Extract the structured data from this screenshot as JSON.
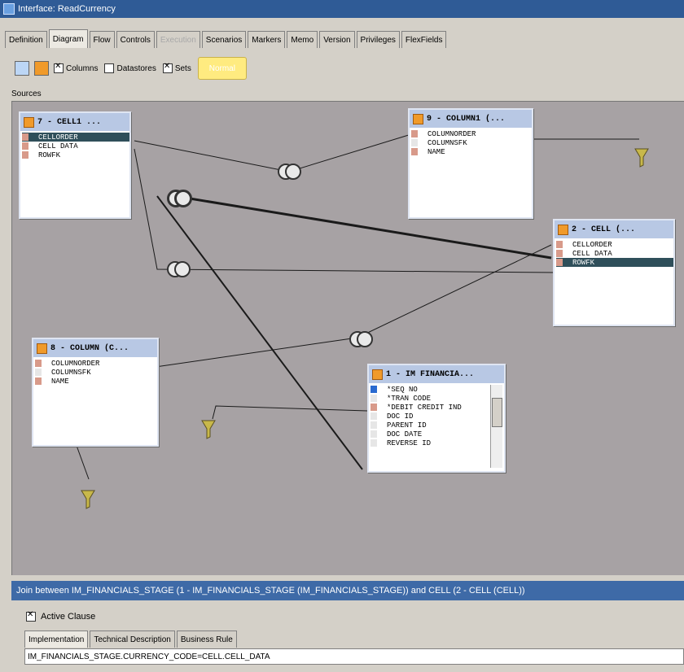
{
  "window": {
    "title": "Interface: ReadCurrency"
  },
  "tabs": [
    {
      "label": "Definition"
    },
    {
      "label": "Diagram"
    },
    {
      "label": "Flow"
    },
    {
      "label": "Controls"
    },
    {
      "label": "Execution"
    },
    {
      "label": "Scenarios"
    },
    {
      "label": "Markers"
    },
    {
      "label": "Memo"
    },
    {
      "label": "Version"
    },
    {
      "label": "Privileges"
    },
    {
      "label": "FlexFields"
    }
  ],
  "toolbar": {
    "columns_label": "Columns",
    "datastores_label": "Datastores",
    "sets_label": "Sets",
    "yellow_button_label": "Normal"
  },
  "sources_label": "Sources",
  "boxes": {
    "cell1": {
      "title": "7 - CELL1 ...",
      "rows": [
        "CELLORDER",
        "CELL DATA",
        "ROWFK"
      ]
    },
    "column1": {
      "title": "9 - COLUMN1 (...",
      "rows": [
        "COLUMNORDER",
        "COLUMNSFK",
        "NAME"
      ]
    },
    "cell": {
      "title": "2 - CELL (...",
      "rows": [
        "CELLORDER",
        "CELL DATA",
        "ROWFK"
      ]
    },
    "column": {
      "title": "8 - COLUMN (C...",
      "rows": [
        "COLUMNORDER",
        "COLUMNSFK",
        "NAME"
      ]
    },
    "imfin": {
      "title": "1 - IM FINANCIA...",
      "rows": [
        "*SEQ NO",
        "*TRAN CODE",
        "*DEBIT CREDIT IND",
        "DOC ID",
        "PARENT ID",
        "DOC DATE",
        "REVERSE ID"
      ]
    }
  },
  "bottom": {
    "join_title": "Join between IM_FINANCIALS_STAGE (1 - IM_FINANCIALS_STAGE (IM_FINANCIALS_STAGE)) and CELL (2 - CELL (CELL))",
    "active_clause_label": "Active Clause",
    "tabs": [
      {
        "label": "Implementation"
      },
      {
        "label": "Technical Description"
      },
      {
        "label": "Business Rule"
      }
    ],
    "expression": "IM_FINANCIALS_STAGE.CURRENCY_CODE=CELL.CELL_DATA"
  }
}
